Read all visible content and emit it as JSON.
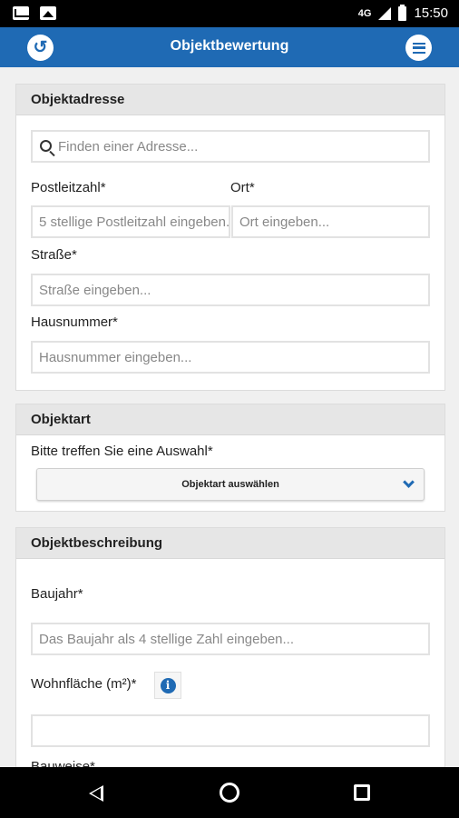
{
  "status_bar": {
    "network": "4G",
    "time": "15:50"
  },
  "app_bar": {
    "title": "Objektbewertung",
    "back_icon": "back-arrow-icon",
    "menu_icon": "menu-icon"
  },
  "colors": {
    "brand": "#1f6ab4",
    "status_bar": "#000000",
    "section_header": "#e6e6e6"
  },
  "sections": {
    "address": {
      "title": "Objektadresse",
      "search_placeholder": "Finden einer Adresse...",
      "postal_label": "Postleitzahl*",
      "postal_placeholder": "5 stellige Postleitzahl eingeben...",
      "city_label": "Ort*",
      "city_placeholder": "Ort eingeben...",
      "street_label": "Straße*",
      "street_placeholder": "Straße eingeben...",
      "house_label": "Hausnummer*",
      "house_placeholder": "Hausnummer eingeben..."
    },
    "type": {
      "title": "Objektart",
      "prompt": "Bitte treffen Sie eine Auswahl*",
      "select_value": "Objektart auswählen"
    },
    "description": {
      "title": "Objektbeschreibung",
      "year_label": "Baujahr*",
      "year_placeholder": "Das Baujahr als 4 stellige Zahl eingeben...",
      "area_label": "Wohnfläche (m²)*",
      "area_value": "",
      "construction_label": "Bauweise*"
    }
  }
}
